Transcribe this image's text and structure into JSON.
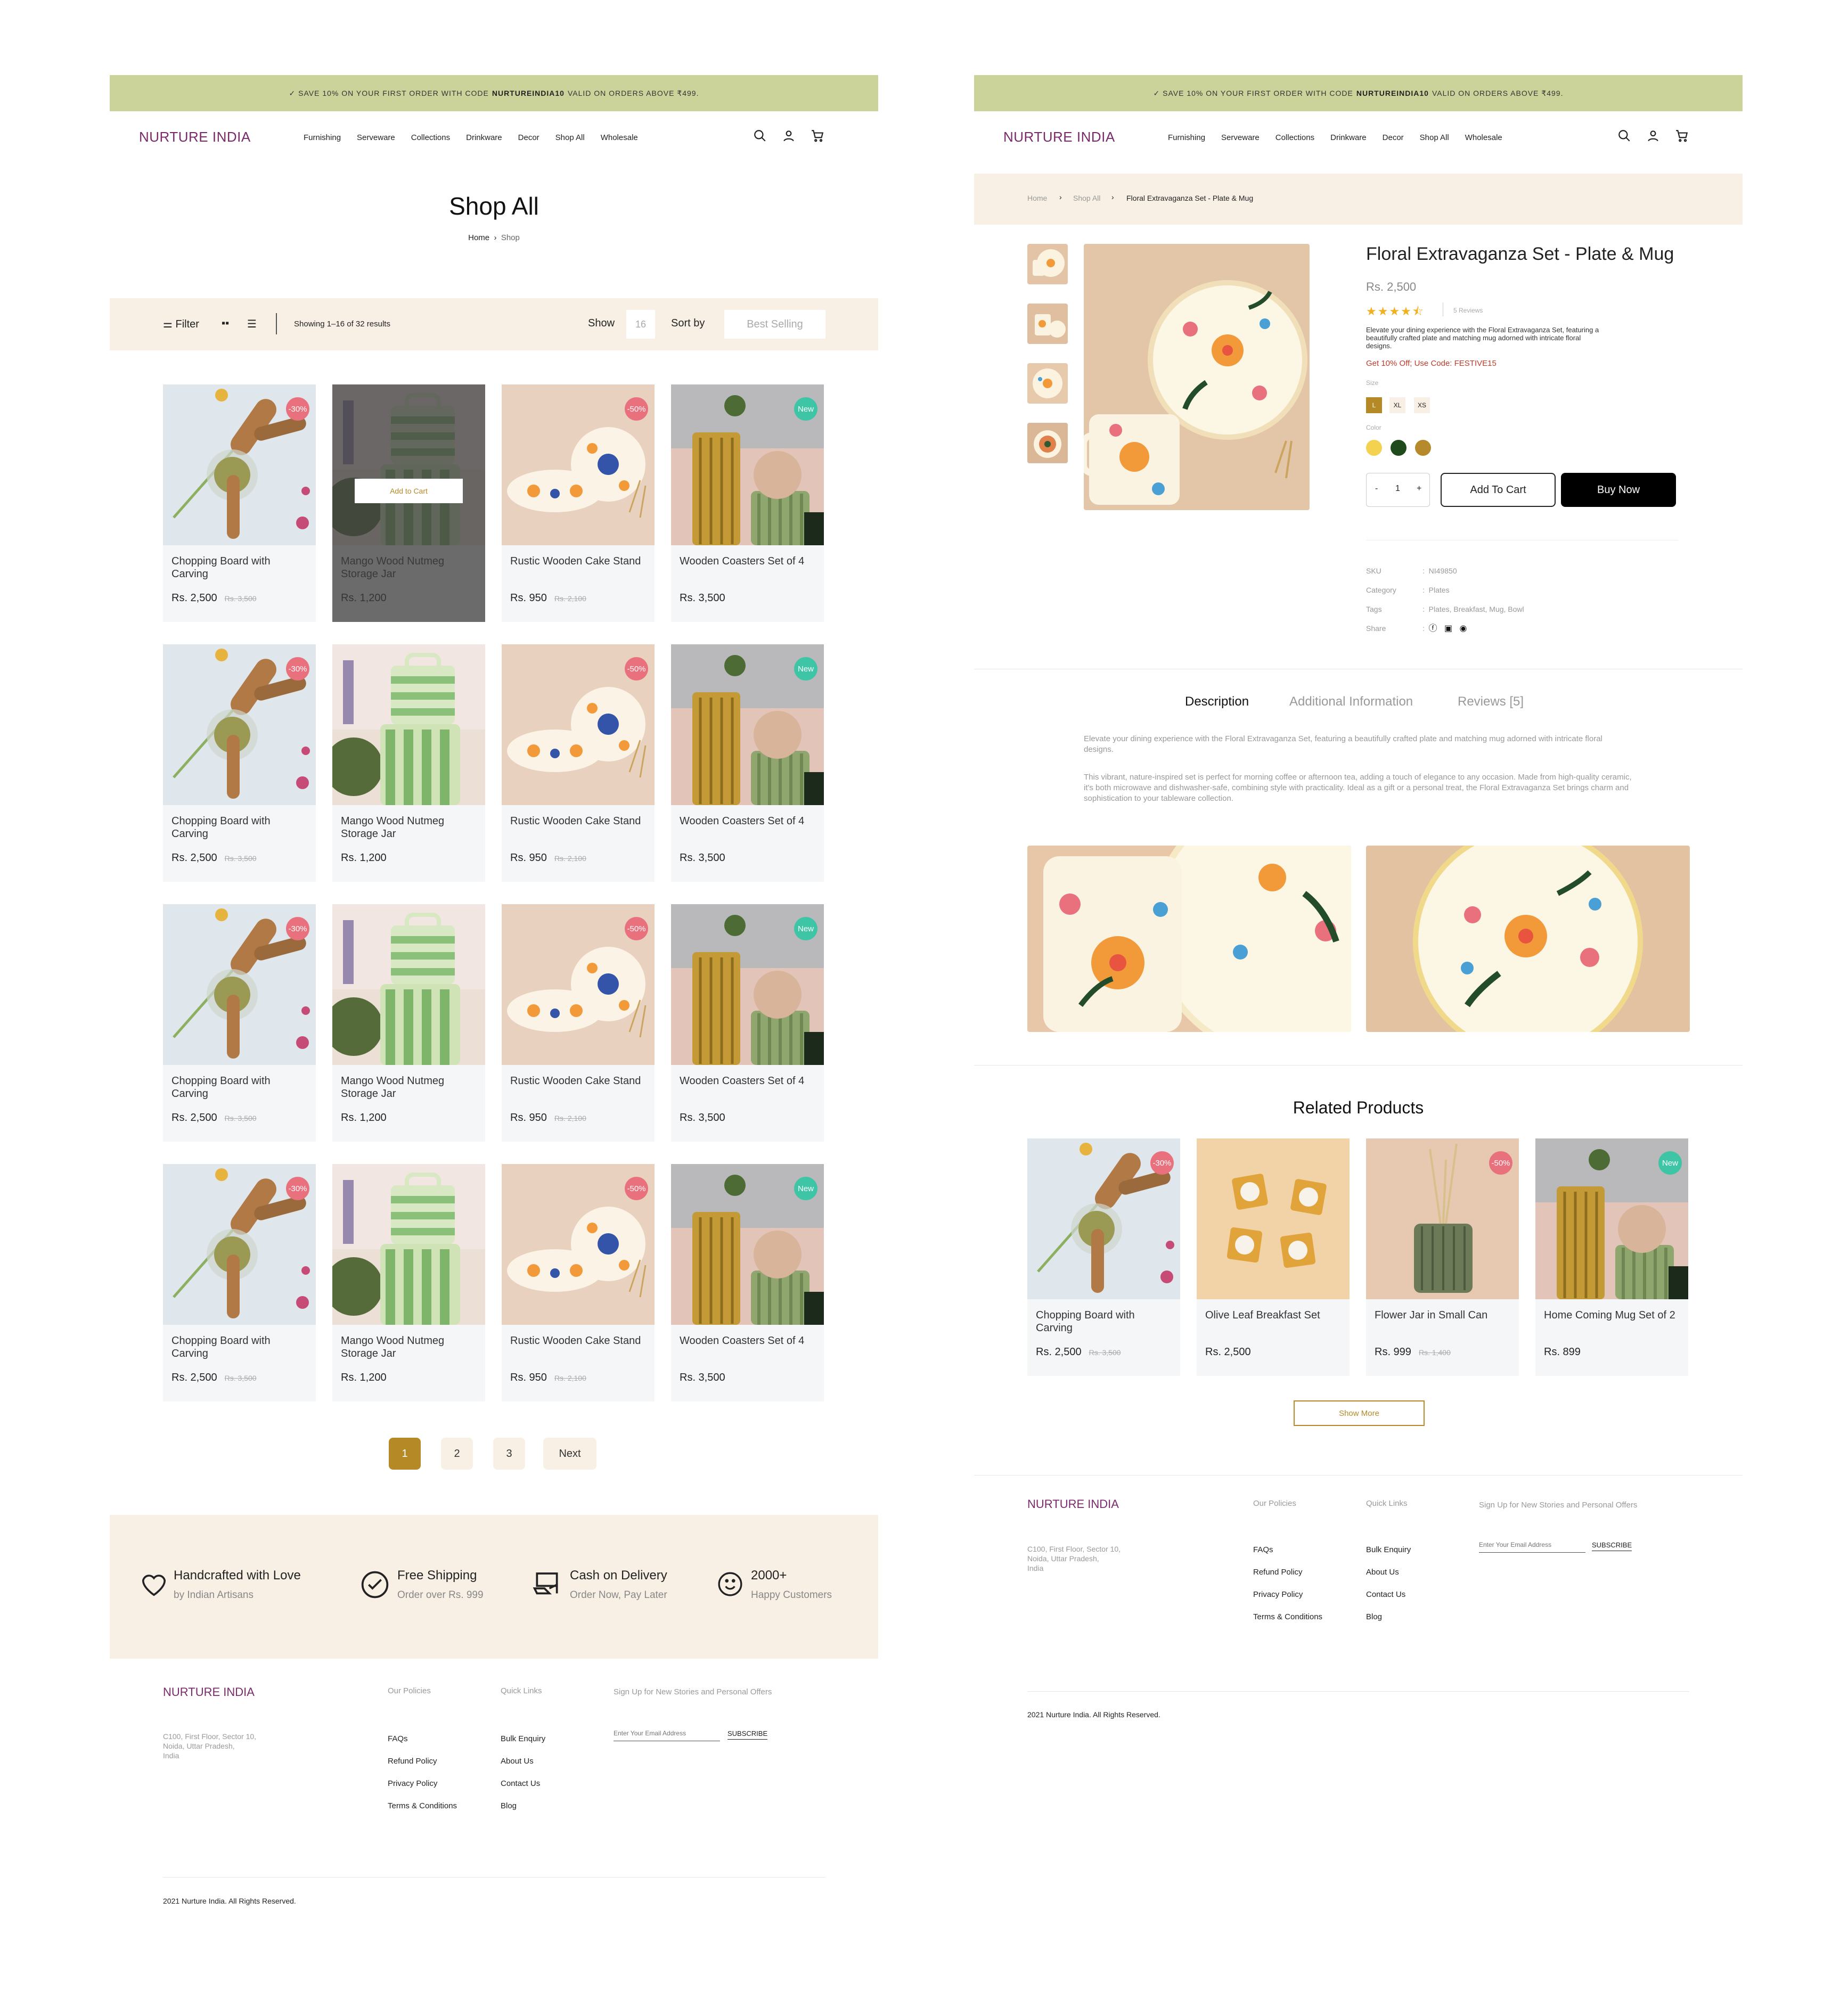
{
  "promo": {
    "save": "✓ SAVE 10% ON YOUR FIRST ORDER WITH CODE",
    "code": "NURTUREINDIA10",
    "rest": "VALID ON ORDERS ABOVE ₹499."
  },
  "logo": "NURTURE INDIA",
  "nav": [
    "Furnishing",
    "Serveware",
    "Collections",
    "Drinkware",
    "Decor",
    "Shop All",
    "Wholesale"
  ],
  "shop": {
    "title": "Shop All",
    "crumb_home": "Home",
    "crumb_current": "Shop",
    "filter": "Filter",
    "results": "Showing 1–16 of 32 results",
    "show_label": "Show",
    "show_value": "16",
    "sort_label": "Sort by",
    "sort_value": "Best Selling",
    "add_to_cart": "Add to Cart",
    "products": [
      {
        "name": "Chopping Board with Carving",
        "price": "Rs. 2,500",
        "old": "Rs. 3,500",
        "badge": "-30%",
        "img": "board"
      },
      {
        "name": "Mango Wood Nutmeg Storage Jar",
        "price": "Rs. 1,200",
        "old": "",
        "badge": "",
        "img": "jar"
      },
      {
        "name": "Rustic Wooden Cake Stand",
        "price": "Rs. 950",
        "old": "Rs. 2,100",
        "badge": "-50%",
        "img": "plates"
      },
      {
        "name": "Wooden Coasters Set of 4",
        "price": "Rs. 3,500",
        "old": "",
        "badge": "New",
        "img": "vase"
      }
    ],
    "pages": [
      "1",
      "2",
      "3",
      "Next"
    ]
  },
  "features": [
    {
      "t": "Handcrafted with Love",
      "s": "by Indian Artisans"
    },
    {
      "t": "Free Shipping",
      "s": "Order over Rs. 999"
    },
    {
      "t": "Cash on Delivery",
      "s": "Order Now, Pay Later"
    },
    {
      "t": "2000+",
      "s": "Happy Customers"
    }
  ],
  "footer": {
    "address": [
      "C100, First Floor, Sector 10,",
      "Noida, Uttar Pradesh,",
      "India"
    ],
    "policies_title": "Our Policies",
    "policies": [
      "FAQs",
      "Refund Policy",
      "Privacy Policy",
      "Terms & Conditions"
    ],
    "links_title": "Quick Links",
    "links": [
      "Bulk Enquiry",
      "About Us",
      "Contact Us",
      "Blog"
    ],
    "signup": "Sign Up for New Stories and Personal Offers",
    "email_placeholder": "Enter Your Email Address",
    "subscribe": "SUBSCRIBE",
    "copyright": "2021 Nurture India. All Rights Reserved."
  },
  "product": {
    "crumb": [
      "Home",
      "Shop All",
      "Floral Extravaganza Set - Plate & Mug"
    ],
    "title": "Floral Extravaganza Set - Plate & Mug",
    "price": "Rs. 2,500",
    "rating": 4.5,
    "reviews": "5 Reviews",
    "desc": "Elevate your dining experience with the Floral Extravaganza Set, featuring a beautifully crafted plate and matching mug adorned with intricate floral designs.",
    "offer": "Get 10% Off; Use Code: FESTIVE15",
    "size_label": "Size",
    "sizes": [
      "L",
      "XL",
      "XS"
    ],
    "color_label": "Color",
    "colors": [
      "#f2d24f",
      "#1f4a1c",
      "#b48a2c"
    ],
    "qty": "1",
    "minus": "-",
    "plus": "+",
    "add": "Add To Cart",
    "buy": "Buy Now",
    "meta": [
      {
        "k": "SKU",
        "v": "NI49850"
      },
      {
        "k": "Category",
        "v": "Plates"
      },
      {
        "k": "Tags",
        "v": "Plates, Breakfast, Mug, Bowl"
      },
      {
        "k": "Share",
        "v": ""
      }
    ],
    "tabs": [
      "Description",
      "Additional Information",
      "Reviews [5]"
    ],
    "tab_p1": "Elevate your dining experience with the Floral Extravaganza Set, featuring a beautifully crafted plate and matching mug adorned with intricate floral designs.",
    "tab_p2": "This vibrant, nature-inspired set is perfect for morning coffee or afternoon tea, adding a touch of elegance to any occasion. Made from high-quality ceramic, it's both microwave and dishwasher-safe, combining style with practicality. Ideal as a gift or a personal treat, the Floral Extravaganza Set brings charm and sophistication to your tableware collection.",
    "related_title": "Related Products",
    "related": [
      {
        "name": "Chopping Board with Carving",
        "price": "Rs. 2,500",
        "old": "Rs. 3,500",
        "badge": "-30%",
        "img": "board"
      },
      {
        "name": "Olive Leaf Breakfast Set",
        "price": "Rs. 2,500",
        "old": "",
        "badge": "",
        "img": "candles"
      },
      {
        "name": "Flower Jar in Small Can",
        "price": "Rs. 999",
        "old": "Rs. 1,400",
        "badge": "-50%",
        "img": "can"
      },
      {
        "name": "Home Coming Mug Set of 2",
        "price": "Rs. 899",
        "old": "",
        "badge": "New",
        "img": "vase"
      }
    ],
    "show_more": "Show More"
  },
  "colors": {
    "promo": "#ccd39a",
    "accent": "#b58a26",
    "beige": "#f8efe5",
    "brand": "#7a2a6b"
  }
}
